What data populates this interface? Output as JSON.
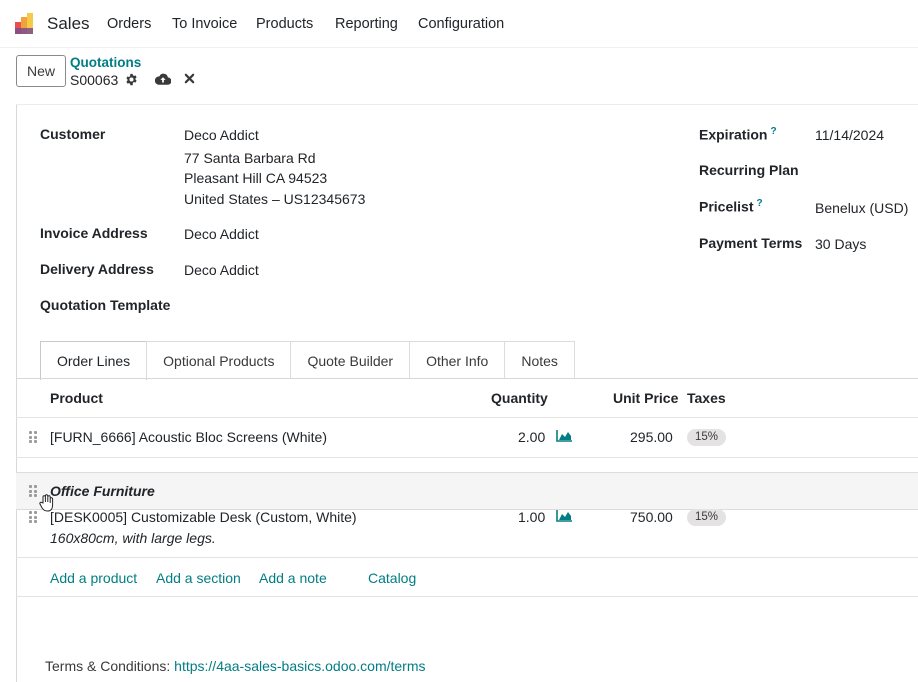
{
  "nav": {
    "app_name": "Sales",
    "menu": [
      "Orders",
      "To Invoice",
      "Products",
      "Reporting",
      "Configuration"
    ]
  },
  "control": {
    "new_label": "New",
    "breadcrumb_parent": "Quotations",
    "breadcrumb_current": "S00063"
  },
  "form": {
    "customer_label": "Customer",
    "customer_name": "Deco Addict",
    "customer_address": [
      "77 Santa Barbara Rd",
      "Pleasant Hill CA 94523",
      "United States – US12345673"
    ],
    "invoice_address_label": "Invoice Address",
    "invoice_address": "Deco Addict",
    "delivery_address_label": "Delivery Address",
    "delivery_address": "Deco Addict",
    "quotation_template_label": "Quotation Template",
    "expiration_label": "Expiration",
    "expiration_value": "11/14/2024",
    "recurring_plan_label": "Recurring Plan",
    "pricelist_label": "Pricelist",
    "pricelist_value": "Benelux (USD)",
    "payment_terms_label": "Payment Terms",
    "payment_terms_value": "30 Days",
    "help_mark": "?"
  },
  "tabs": [
    "Order Lines",
    "Optional Products",
    "Quote Builder",
    "Other Info",
    "Notes"
  ],
  "active_tab": "Order Lines",
  "table": {
    "columns": [
      "Product",
      "Quantity",
      "Unit Price",
      "Taxes"
    ],
    "rows": [
      {
        "product": "[FURN_6666] Acoustic Bloc Screens (White)",
        "quantity": "2.00",
        "unit_price": "295.00",
        "tax": "15%"
      },
      {
        "product": "[DESK0005] Customizable Desk (Custom, White)",
        "description": "160x80cm, with large legs.",
        "quantity": "1.00",
        "unit_price": "750.00",
        "tax": "15%"
      }
    ],
    "section_name": "Office Furniture",
    "actions": [
      "Add a product",
      "Add a section",
      "Add a note",
      "Catalog"
    ]
  },
  "terms": {
    "label": "Terms & Conditions:",
    "url": "https://4aa-sales-basics.odoo.com/terms"
  },
  "colors": {
    "accent": "#017e84",
    "brand": "#714b67"
  }
}
